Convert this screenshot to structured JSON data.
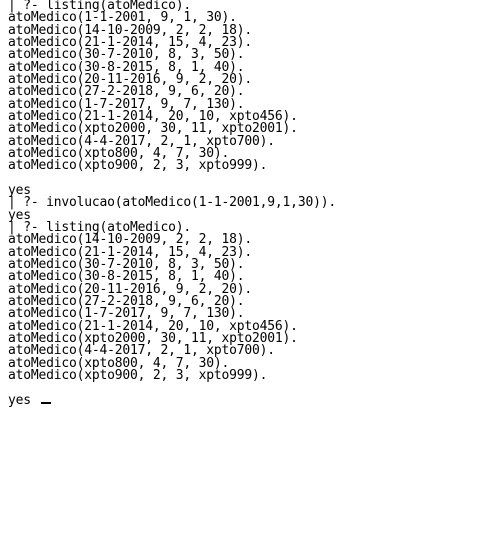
{
  "terminal": {
    "lines": [
      "| ?- listing(atoMedico).",
      "atoMedico(1-1-2001, 9, 1, 30).",
      "atoMedico(14-10-2009, 2, 2, 18).",
      "atoMedico(21-1-2014, 15, 4, 23).",
      "atoMedico(30-7-2010, 8, 3, 50).",
      "atoMedico(30-8-2015, 8, 1, 40).",
      "atoMedico(20-11-2016, 9, 2, 20).",
      "atoMedico(27-2-2018, 9, 6, 20).",
      "atoMedico(1-7-2017, 9, 7, 130).",
      "atoMedico(21-1-2014, 20, 10, xpto456).",
      "atoMedico(xpto2000, 30, 11, xpto2001).",
      "atoMedico(4-4-2017, 2, 1, xpto700).",
      "atoMedico(xpto800, 4, 7, 30).",
      "atoMedico(xpto900, 2, 3, xpto999).",
      "",
      "yes",
      "| ?- involucao(atoMedico(1-1-2001,9,1,30)).",
      "yes",
      "| ?- listing(atoMedico).",
      "atoMedico(14-10-2009, 2, 2, 18).",
      "atoMedico(21-1-2014, 15, 4, 23).",
      "atoMedico(30-7-2010, 8, 3, 50).",
      "atoMedico(30-8-2015, 8, 1, 40).",
      "atoMedico(20-11-2016, 9, 2, 20).",
      "atoMedico(27-2-2018, 9, 6, 20).",
      "atoMedico(1-7-2017, 9, 7, 130).",
      "atoMedico(21-1-2014, 20, 10, xpto456).",
      "atoMedico(xpto2000, 30, 11, xpto2001).",
      "atoMedico(4-4-2017, 2, 1, xpto700).",
      "atoMedico(xpto800, 4, 7, 30).",
      "atoMedico(xpto900, 2, 3, xpto999).",
      "",
      "yes"
    ],
    "colors": {
      "background": "#ffffff",
      "text": "#000000"
    }
  }
}
